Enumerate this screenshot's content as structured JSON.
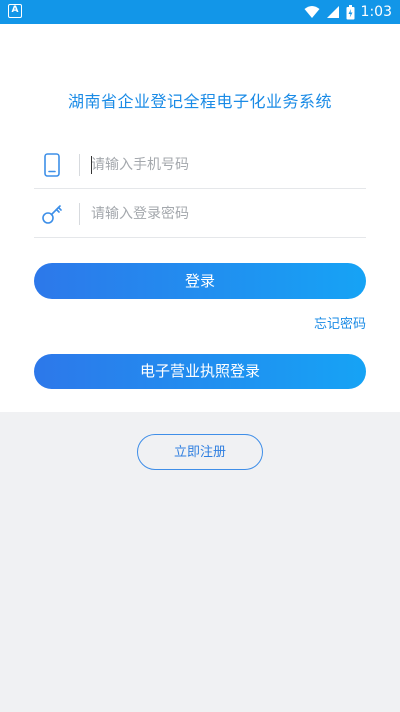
{
  "status_bar": {
    "time": "1:03",
    "left_badge": "A"
  },
  "app": {
    "title": "湖南省企业登记全程电子化业务系统"
  },
  "login_form": {
    "phone_placeholder": "请输入手机号码",
    "phone_value": "",
    "password_placeholder": "请输入登录密码",
    "password_value": "",
    "login_label": "登录",
    "forgot_label": "忘记密码",
    "license_login_label": "电子营业执照登录"
  },
  "footer": {
    "register_label": "立即注册"
  },
  "icons": {
    "phone": "phone-icon",
    "key": "key-icon",
    "wifi": "wifi-icon",
    "signal": "signal-icon",
    "battery": "battery-icon"
  },
  "colors": {
    "status_bar": "#1296e8",
    "accent": "#1a8be6",
    "button_start": "#2d78ea",
    "button_end": "#16a3f5",
    "page_bg": "#f0f1f3"
  }
}
